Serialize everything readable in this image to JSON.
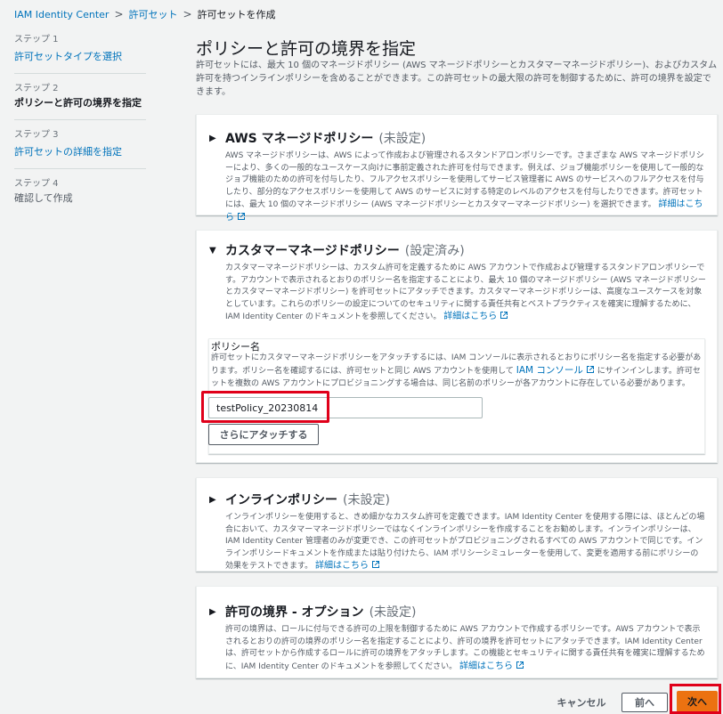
{
  "breadcrumb": {
    "items": [
      "IAM Identity Center",
      "許可セット"
    ],
    "current": "許可セットを作成"
  },
  "steps": [
    {
      "num": "ステップ 1",
      "label": "許可セットタイプを選択"
    },
    {
      "num": "ステップ 2",
      "label": "ポリシーと許可の境界を指定"
    },
    {
      "num": "ステップ 3",
      "label": "許可セットの詳細を指定"
    },
    {
      "num": "ステップ 4",
      "label": "確認して作成"
    }
  ],
  "page": {
    "title": "ポリシーと許可の境界を指定",
    "description": "許可セットには、最大 10 個のマネージドポリシー (AWS マネージドポリシーとカスタマーマネージドポリシー)、およびカスタム許可を持つインラインポリシーを含めることができます。この許可セットの最大限の許可を制御するために、許可の境界を設定できます。"
  },
  "sections": {
    "aws_managed": {
      "title": "AWS マネージドポリシー",
      "status": "(未設定)",
      "body": "AWS マネージドポリシーは、AWS によって作成および管理されるスタンドアロンポリシーです。さまざまな AWS マネージドポリシーにより、多くの一般的なユースケース向けに事前定義された許可を付与できます。例えば、ジョブ機能ポリシーを使用して一般的なジョブ機能のための許可を付与したり、フルアクセスポリシーを使用してサービス管理者に AWS のサービスへのフルアクセスを付与したり、部分的なアクセスポリシーを使用して AWS のサービスに対する特定のレベルのアクセスを付与したりできます。許可セットには、最大 10 個のマネージドポリシー (AWS マネージドポリシーとカスタマーマネージドポリシー) を選択できます。",
      "link": "詳細はこちら"
    },
    "customer_managed": {
      "title": "カスタマーマネージドポリシー",
      "status": "(設定済み)",
      "body": "カスタマーマネージドポリシーは、カスタム許可を定義するために AWS アカウントで作成および管理するスタンドアロンポリシーです。アカウントで表示されるとおりのポリシー名を指定することにより、最大 10 個のマネージドポリシー (AWS マネージドポリシーとカスタマーマネージドポリシー) を許可セットにアタッチできます。カスタマーマネージドポリシーは、高度なユースケースを対象としています。これらのポリシーの設定についてのセキュリティに関する責任共有とベストプラクティスを確実に理解するために、IAM Identity Center のドキュメントを参照してください。",
      "link": "詳細はこちら",
      "policy_label": "ポリシー名",
      "policy_desc_1": "許可セットにカスタマーマネージドポリシーをアタッチするには、IAM コンソールに表示されるとおりにポリシー名を指定する必要があります。ポリシー名を確認するには、許可セットと同じ AWS アカウントを使用して",
      "policy_desc_link": "IAM コンソール",
      "policy_desc_2": "にサインインします。許可セットを複数の AWS アカウントにプロビジョニングする場合は、同じ名前のポリシーが各アカウントに存在している必要があります。",
      "policy_value": "testPolicy_20230814",
      "attach_label": "さらにアタッチする"
    },
    "inline": {
      "title": "インラインポリシー",
      "status": "(未設定)",
      "body": "インラインポリシーを使用すると、きめ細かなカスタム許可を定義できます。IAM Identity Center を使用する際には、ほとんどの場合において、カスタマーマネージドポリシーではなくインラインポリシーを作成することをお勧めします。インラインポリシーは、IAM Identity Center 管理者のみが変更でき、この許可セットがプロビジョニングされるすべての AWS アカウントで同じです。インラインポリシードキュメントを作成または貼り付けたら、IAM ポリシーシミュレーターを使用して、変更を適用する前にポリシーの効果をテストできます。",
      "link": "詳細はこちら"
    },
    "boundary": {
      "title": "許可の境界 - オプション",
      "status": "(未設定)",
      "body": "許可の境界は、ロールに付与できる許可の上限を制御するために AWS アカウントで作成するポリシーです。AWS アカウントで表示されるとおりの許可の境界のポリシー名を指定することにより、許可の境界を許可セットにアタッチできます。IAM Identity Center は、許可セットから作成するロールに許可の境界をアタッチします。この機能とセキュリティに関する責任共有を確実に理解するために、IAM Identity Center のドキュメントを参照してください。",
      "link": "詳細はこちら"
    }
  },
  "footer": {
    "cancel": "キャンセル",
    "prev": "前へ",
    "next": "次へ"
  },
  "colors": {
    "link": "#0073bb",
    "primary": "#ec7211",
    "highlight": "#e0001a"
  }
}
